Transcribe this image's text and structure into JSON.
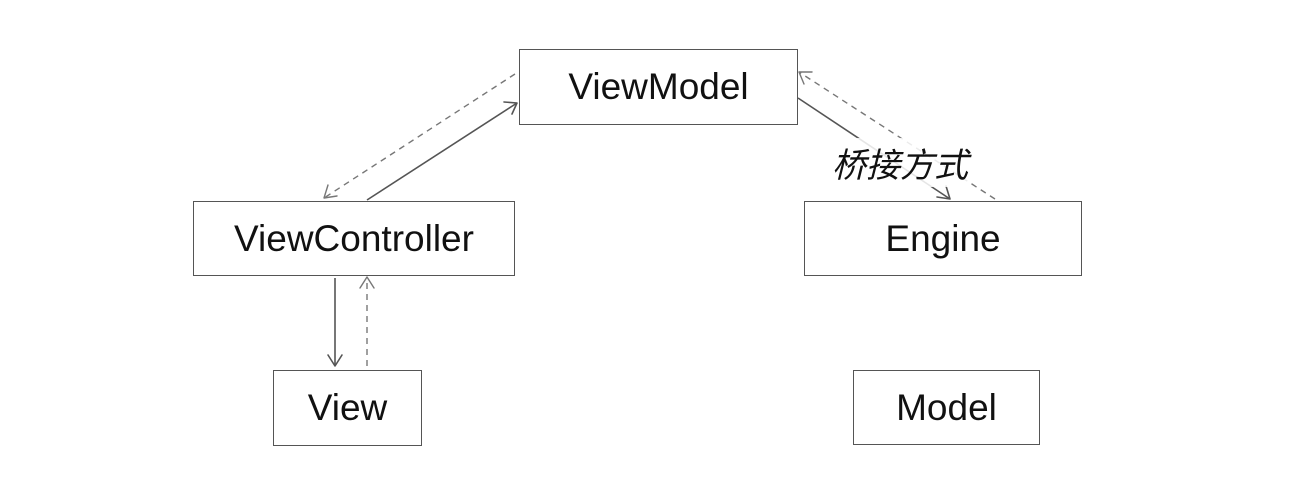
{
  "nodes": {
    "viewmodel": "ViewModel",
    "viewcontroller": "ViewController",
    "engine": "Engine",
    "view": "View",
    "model": "Model"
  },
  "edge_labels": {
    "viewmodel_engine": "桥接方式"
  },
  "colors": {
    "background": "#ffffff",
    "border": "#555555",
    "text": "#111111",
    "dashed_line": "#777777"
  }
}
